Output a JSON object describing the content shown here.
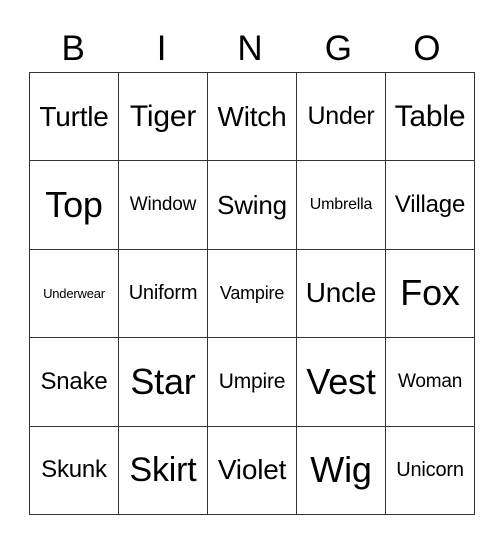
{
  "header": [
    "B",
    "I",
    "N",
    "G",
    "O"
  ],
  "rows": [
    [
      "Turtle",
      "Tiger",
      "Witch",
      "Under",
      "Table"
    ],
    [
      "Top",
      "Window",
      "Swing",
      "Umbrella",
      "Village"
    ],
    [
      "Underwear",
      "Uniform",
      "Vampire",
      "Uncle",
      "Fox"
    ],
    [
      "Snake",
      "Star",
      "Umpire",
      "Vest",
      "Woman"
    ],
    [
      "Skunk",
      "Skirt",
      "Violet",
      "Wig",
      "Unicorn"
    ]
  ]
}
